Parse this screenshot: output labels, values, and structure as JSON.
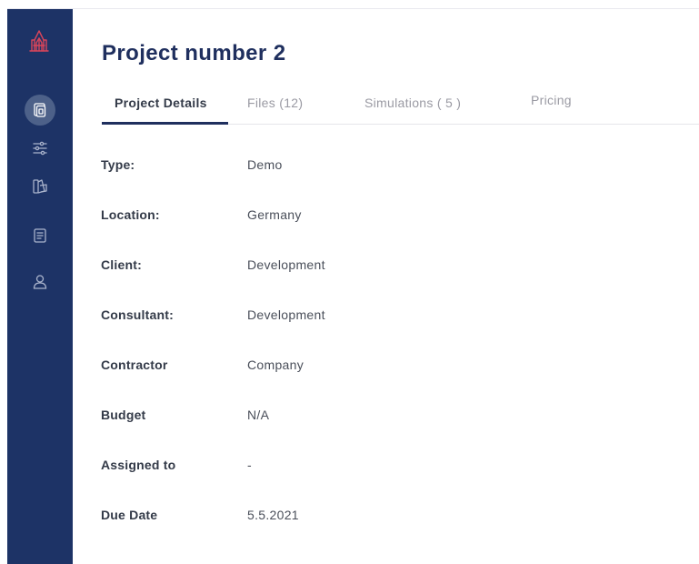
{
  "project": {
    "title": "Project number 2"
  },
  "tabs": [
    {
      "label": "Project Details"
    },
    {
      "label": "Files (12)"
    },
    {
      "label": "Simulations ( 5 )"
    },
    {
      "label": "Pricing"
    }
  ],
  "details": [
    {
      "label": "Type:",
      "value": "Demo"
    },
    {
      "label": "Location:",
      "value": "Germany"
    },
    {
      "label": "Client:",
      "value": "Development"
    },
    {
      "label": "Consultant:",
      "value": "Development"
    },
    {
      "label": "Contractor",
      "value": "Company"
    },
    {
      "label": "Budget",
      "value": "N/A"
    },
    {
      "label": "Assigned to",
      "value": "-"
    },
    {
      "label": "Due Date",
      "value": "5.5.2021"
    }
  ],
  "sidebar": {
    "icons": [
      "logo-icon",
      "projects-icon",
      "filters-icon",
      "materials-icon",
      "documents-icon",
      "user-icon"
    ]
  },
  "colors": {
    "sidebar": "#1d3366",
    "sidebar_active": "#4d6189",
    "accent": "#1f2f5e",
    "logo": "#d9455a"
  }
}
